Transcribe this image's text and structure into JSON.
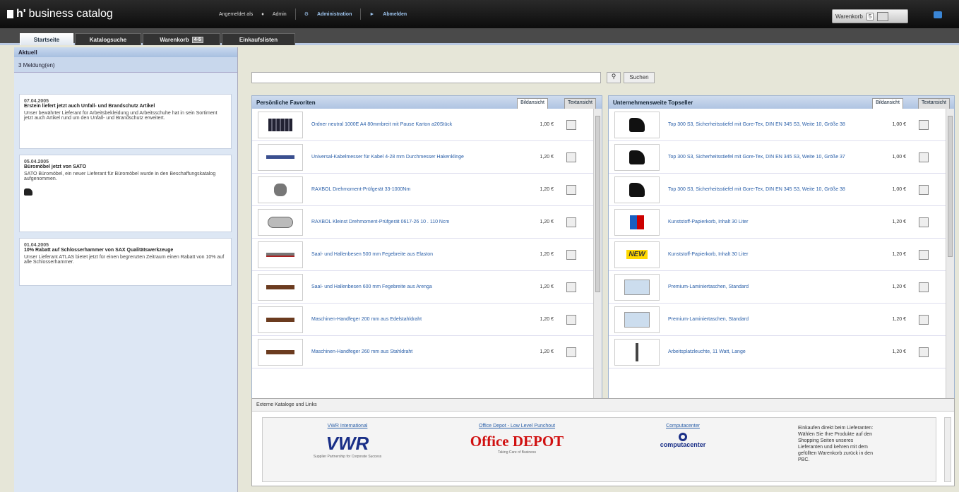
{
  "header": {
    "logo_bold": "h'",
    "logo_text": "business catalog",
    "logged_in": "Angemeldet als",
    "user": "Admin",
    "admin_link": "Administration",
    "logout_link": "Abmelden",
    "cart_label": "Warenkorb",
    "cart_count": "5",
    "accent": "#3a86d6"
  },
  "tabs": [
    {
      "label": "Startseite",
      "active": true
    },
    {
      "label": "Katalogsuche"
    },
    {
      "label": "Warenkorb",
      "badge": "4-5"
    },
    {
      "label": "Einkaufslisten"
    }
  ],
  "sidebar": {
    "title": "Aktuell",
    "count": "3 Meldung(en)",
    "news": [
      {
        "date": "07.04.2005",
        "title": "Erstein liefert jetzt auch Unfall- und Brandschutz Artikel",
        "text": "Unser bewährter Lieferant für Arbeitsbekleidung und Arbeitsschuhe hat in sein Sortiment jetzt auch Artikel rund um den Unfall- und Brandschutz erweitert."
      },
      {
        "date": "05.04.2005",
        "title": "Büromöbel jetzt von SATO",
        "text": "SATO Büromöbel, ein neuer Lieferant für Büromöbel wurde in den Beschaffungskatalog aufgenommen."
      },
      {
        "date": "01.04.2005",
        "title": "10% Rabatt auf Schlosserhammer von SAX Qualitätswerkzeuge",
        "text": "Unser Lieferant ATLAS bietet jetzt für einen begrenzten Zeitraum einen Rabatt von 10% auf alle Schlosserhammer."
      }
    ]
  },
  "search": {
    "button_label": "Suchen",
    "icon": "search-icon"
  },
  "favorites": {
    "title": "Persönliche Favoriten",
    "tab_image": "Bildansicht",
    "tab_text": "Textansicht",
    "items": [
      {
        "name": "Ordner neutral 1000E A4 80mmbreit mit Pause Karton a20Stück",
        "price": "1,00 €"
      },
      {
        "name": "Universal-Kabelmesser für Kabel 4-28 mm Durchmesser Hakenklinge",
        "price": "1,20 €"
      },
      {
        "name": "RAXBOL Drehmoment-Prüfgerät 33-1000Nm",
        "price": "1,20 €"
      },
      {
        "name": "RAXBOL Kleinst Drehmoment-Prüfgerät 0617-26 10 . 110 Ncm",
        "price": "1,20 €"
      },
      {
        "name": "Saal- und Hallenbesen 500 mm Fegebreite aus Elaston",
        "price": "1,20 €"
      },
      {
        "name": "Saal- und Hallenbesen 600 mm Fegebreite aus Arenga",
        "price": "1,20 €"
      },
      {
        "name": "Maschinen-Handfeger 200 mm aus Edelstahldraht",
        "price": "1,20 €"
      },
      {
        "name": "Maschinen-Handfeger 260 mm aus Stahldraht",
        "price": "1,20 €"
      }
    ]
  },
  "toplist": {
    "title": "Unternehmensweite Topseller",
    "tab_image": "Bildansicht",
    "tab_text": "Textansicht",
    "items": [
      {
        "name": "Top 300 S3, Sicherheitsstiefel mit Gore-Tex, DIN EN 345 S3, Weite 10, Größe 38",
        "price": "1,00 €"
      },
      {
        "name": "Top 300 S3, Sicherheitsstiefel mit Gore-Tex, DIN EN 345 S3, Weite 10, Größe 37",
        "price": "1,00 €"
      },
      {
        "name": "Top 300 S3, Sicherheitsstiefel mit Gore-Tex, DIN EN 345 S3, Weite 10, Größe 38",
        "price": "1,00 €"
      },
      {
        "name": "Kunststoff-Papierkorb, Inhalt 30 Liter",
        "price": "1,20 €"
      },
      {
        "name": "Kunststoff-Papierkorb, Inhalt 30 Liter",
        "price": "1,20 €",
        "new": "NEW"
      },
      {
        "name": "Premium-Laminiertaschen, Standard",
        "price": "1,20 €"
      },
      {
        "name": "Premium-Laminiertaschen, Standard",
        "price": "1,20 €"
      },
      {
        "name": "Arbeitsplatzleuchte, 11 Watt, Lange",
        "price": "1,20 €"
      }
    ]
  },
  "external": {
    "title": "Externe Kataloge und Links",
    "links": [
      {
        "link": "VWR International",
        "logo": "VWR",
        "tagline": "Supplier Partnership for Corporate Success"
      },
      {
        "link": "Office Depot - Low Level Punchout",
        "logo": "Office DEPOT",
        "tagline": "Taking Care of Business"
      },
      {
        "link": "Computacenter",
        "logo": "computacenter"
      }
    ],
    "info": "Einkaufen direkt beim Lieferanten: Wählen Sie Ihre Produkte auf den Shopping Seiten unseres Lieferanten und kehren mit dem gefüllten Warenkorb zurück in den PBC."
  }
}
